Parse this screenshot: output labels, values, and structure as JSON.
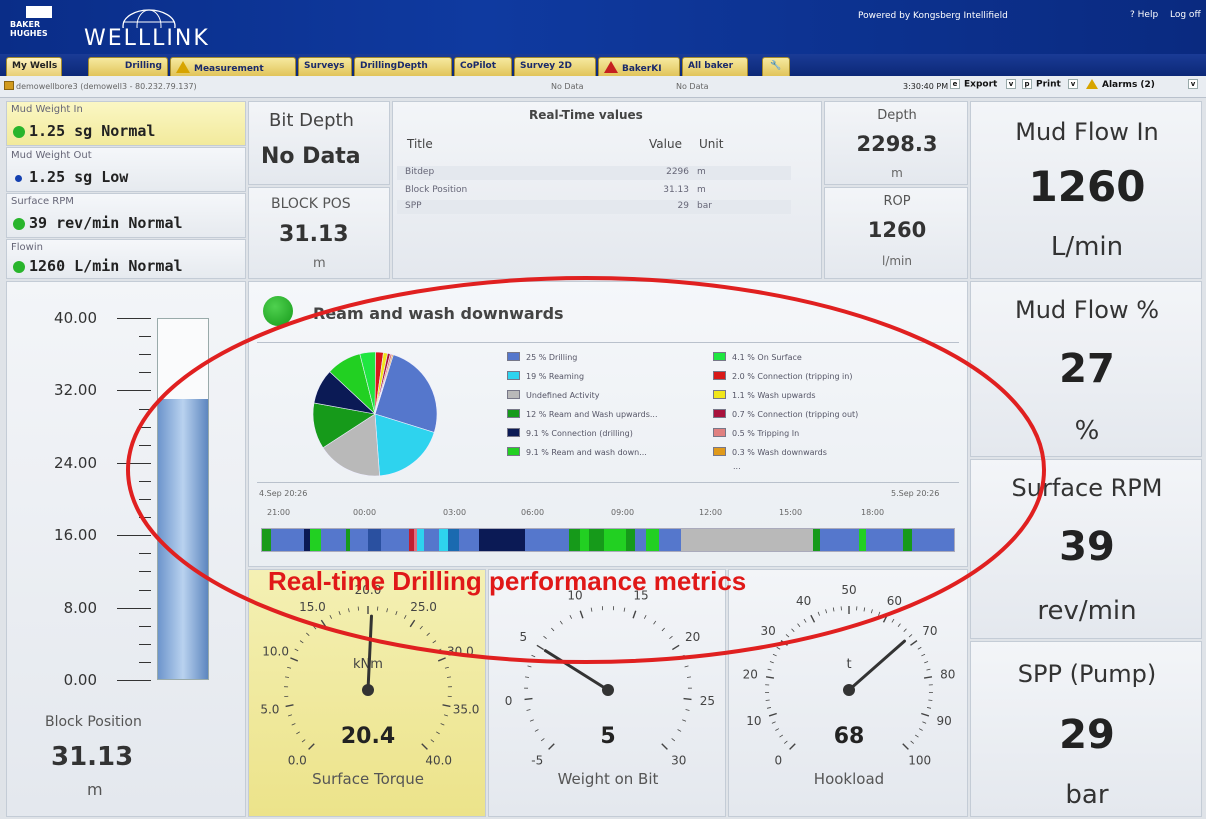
{
  "header": {
    "brand_small": "BAKER HUGHES",
    "app_name": "WELLLINK",
    "powered_by": "Powered by Kongsberg Intellifield",
    "help": "? Help",
    "logoff": "Log off"
  },
  "tabs": [
    "My Wells",
    "Drilling",
    "Measurement",
    "Surveys",
    "DrillingDepth",
    "CoPilot",
    "Survey 2D",
    "BakerKI",
    "All baker"
  ],
  "statusbar": {
    "well": "demowellbore3 (demowell3 - 80.232.79.137)",
    "nodata1": "No Data",
    "nodata2": "No Data",
    "time": "3:30:40 PM",
    "export": "Export",
    "print": "Print",
    "alarms": "Alarms (2)"
  },
  "status_boxes": [
    {
      "title": "Mud Weight In",
      "value": "1.25 sg  Normal"
    },
    {
      "title": "Mud Weight Out",
      "value": "1.25 sg  Low"
    },
    {
      "title": "Surface RPM",
      "value": "39 rev/min  Normal"
    },
    {
      "title": "Flowin",
      "value": "1260 L/min  Normal"
    }
  ],
  "bit_depth": {
    "title": "Bit Depth",
    "value": "No Data"
  },
  "block_pos": {
    "title": "BLOCK POS",
    "value": "31.13",
    "unit": "m"
  },
  "realtime": {
    "title": "Real-Time values",
    "col_title": "Title",
    "col_value": "Value",
    "col_unit": "Unit",
    "rows": [
      {
        "title": "Bitdep",
        "value": "2296",
        "unit": "m"
      },
      {
        "title": "Block Position",
        "value": "31.13",
        "unit": "m"
      },
      {
        "title": "SPP",
        "value": "29",
        "unit": "bar"
      }
    ]
  },
  "depth": {
    "title": "Depth",
    "value": "2298.3",
    "unit": "m"
  },
  "rop": {
    "title": "ROP",
    "value": "1260",
    "unit": "l/min"
  },
  "right_panels": [
    {
      "title": "Mud Flow In",
      "value": "1260",
      "unit": "L/min"
    },
    {
      "title": "Mud Flow %",
      "value": "27",
      "unit": "%"
    },
    {
      "title": "Surface RPM",
      "value": "39",
      "unit": "rev/min"
    },
    {
      "title": "SPP (Pump)",
      "value": "29",
      "unit": "bar"
    }
  ],
  "block_chart": {
    "ticks": [
      "40.00",
      "32.00",
      "24.00",
      "16.00",
      "8.00",
      "0.00"
    ],
    "max": 40,
    "level": 31.13,
    "label": "Block Position",
    "value": "31.13",
    "unit": "m"
  },
  "activity": {
    "title": "Ream and wash downwards",
    "start": "4.Sep 20:26",
    "end": "5.Sep 20:26",
    "times": [
      "21:00",
      "00:00",
      "03:00",
      "06:00",
      "09:00",
      "12:00",
      "15:00",
      "18:00"
    ],
    "more": "...",
    "colors": {
      "drilling": "#5577cc",
      "reaming": "#2ed3ee",
      "undefined": "#b9b9b9",
      "ream_up": "#169a1a",
      "conn_drill": "#0b1a55",
      "ream_down": "#22d022"
    }
  },
  "chart_data": {
    "type": "pie",
    "categories": [
      "Drilling",
      "Reaming",
      "Undefined Activity",
      "Ream and Wash upwards...",
      "Connection (drilling)",
      "Ream and wash down...",
      "On Surface",
      "Connection (tripping in)",
      "Wash upwards",
      "Connection (tripping out)",
      "Tripping In",
      "Wash downwards"
    ],
    "legend_labels": [
      "25 % Drilling",
      "19 % Reaming",
      "Undefined Activity",
      "12 % Ream and Wash upwards...",
      "9.1 % Connection (drilling)",
      "9.1 % Ream and wash down...",
      "4.1 % On Surface",
      "2.0 % Connection (tripping in)",
      "1.1 % Wash upwards",
      "0.7 % Connection (tripping out)",
      "0.5 % Tripping In",
      "0.3 % Wash downwards"
    ],
    "values": [
      25,
      19,
      17,
      12,
      9.1,
      9.1,
      4.1,
      2.0,
      1.1,
      0.7,
      0.5,
      0.3
    ],
    "colors": [
      "#5577cc",
      "#2ed3ee",
      "#b9b9b9",
      "#169a1a",
      "#0b1a55",
      "#22d022",
      "#1fe640",
      "#d81818",
      "#f1e61a",
      "#a8123c",
      "#e08080",
      "#e09a1a"
    ]
  },
  "gauges": [
    {
      "label": "Surface Torque",
      "value": "20.4",
      "unit": "kNm",
      "numbers": [
        "0.0",
        "5.0",
        "10.0",
        "15.0",
        "20.0",
        "25.0",
        "30.0",
        "35.0",
        "40.0"
      ],
      "min": 0,
      "max": 40,
      "reading": 20.4
    },
    {
      "label": "Weight on Bit",
      "value": "5",
      "unit": "",
      "numbers": [
        "-5",
        "0",
        "5",
        "10",
        "15",
        "20",
        "25",
        "30"
      ],
      "min": -5,
      "max": 30,
      "reading": 5
    },
    {
      "label": "Hookload",
      "value": "68",
      "unit": "t",
      "numbers": [
        "0",
        "10",
        "20",
        "30",
        "40",
        "50",
        "60",
        "70",
        "80",
        "90",
        "100"
      ],
      "min": 0,
      "max": 100,
      "reading": 68
    }
  ],
  "annotation": "Real-time Drilling performance metrics"
}
